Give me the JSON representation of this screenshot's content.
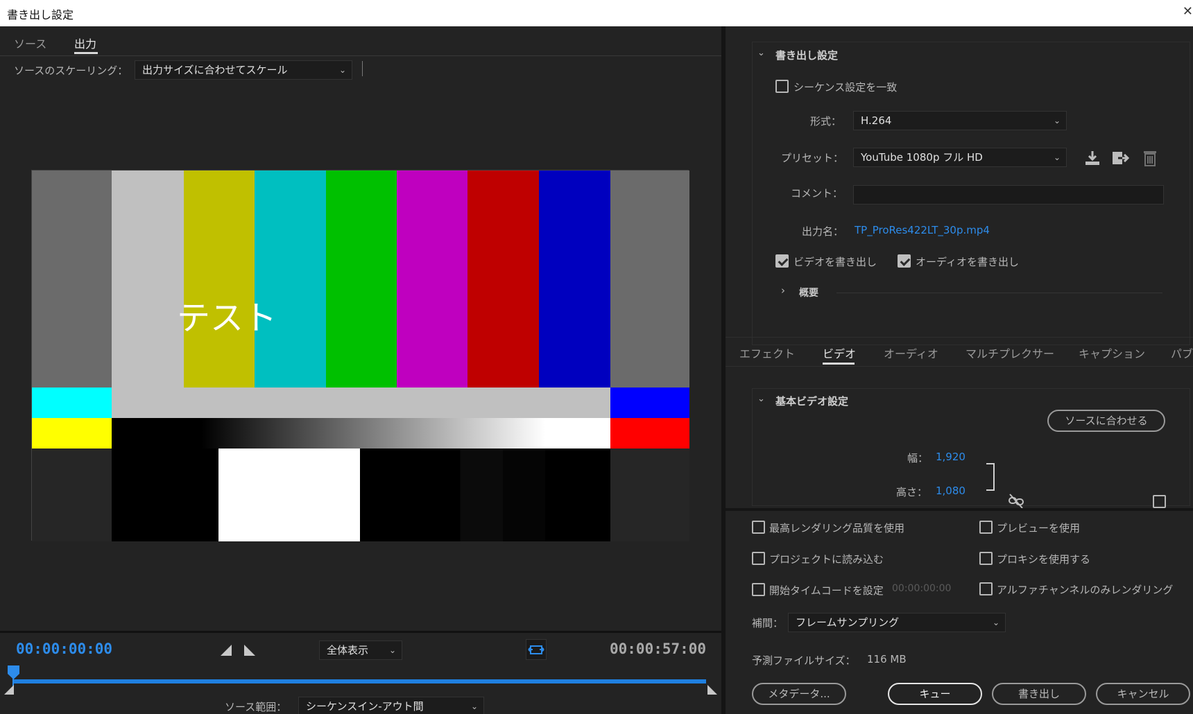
{
  "window": {
    "title": "書き出し設定",
    "close_glyph": "✕"
  },
  "left": {
    "tabs": [
      {
        "label": "ソース"
      },
      {
        "label": "出力"
      }
    ],
    "active_tab": "出力",
    "scaling": {
      "label": "ソースのスケーリング：",
      "value": "出力サイズに合わせてスケール"
    },
    "preview_overlay_text": "テスト",
    "timeline": {
      "current_time": "00:00:00:00",
      "end_time": "00:00:57:00",
      "zoom": "全体表示",
      "source_range_label": "ソース範囲：",
      "source_range_value": "シーケンスイン-アウト間"
    }
  },
  "export_settings": {
    "header": "書き出し設定",
    "match_sequence": {
      "label": "シーケンス設定を一致",
      "checked": false
    },
    "format": {
      "label": "形式：",
      "value": "H.264"
    },
    "preset": {
      "label": "プリセット：",
      "value": "YouTube  1080p フル HD"
    },
    "comment": {
      "label": "コメント：",
      "value": ""
    },
    "output_name": {
      "label": "出力名：",
      "value": "TP_ProRes422LT_30p.mp4"
    },
    "export_video": {
      "label": "ビデオを書き出し",
      "checked": true
    },
    "export_audio": {
      "label": "オーディオを書き出し",
      "checked": true
    },
    "summary": "概要"
  },
  "settings_tabs": [
    {
      "label": "エフェクト"
    },
    {
      "label": "ビデオ"
    },
    {
      "label": "オーディオ"
    },
    {
      "label": "マルチプレクサー"
    },
    {
      "label": "キャプション"
    },
    {
      "label": "パブ"
    }
  ],
  "active_settings_tab": "ビデオ",
  "basic_video": {
    "header": "基本ビデオ設定",
    "match_source": "ソースに合わせる",
    "width_label": "幅：",
    "width": "1,920",
    "height_label": "高さ：",
    "height": "1,080"
  },
  "options": {
    "max_render_quality": {
      "label": "最高レンダリング品質を使用",
      "checked": false
    },
    "use_previews": {
      "label": "プレビューを使用",
      "checked": false
    },
    "import_into_project": {
      "label": "プロジェクトに読み込む",
      "checked": false
    },
    "use_proxies": {
      "label": "プロキシを使用する",
      "checked": false
    },
    "start_timecode": {
      "label": "開始タイムコードを設定",
      "value": "00:00:00:00",
      "checked": false
    },
    "alpha_only": {
      "label": "アルファチャンネルのみレンダリング",
      "checked": false
    },
    "interpolation": {
      "label": "補間：",
      "value": "フレームサンプリング"
    },
    "estimated_size": {
      "label": "予測ファイルサイズ：",
      "value": "116 MB"
    }
  },
  "buttons": {
    "metadata": "メタデータ...",
    "queue": "キュー",
    "export": "書き出し",
    "cancel": "キャンセル"
  },
  "colors": {
    "accent_blue": "#2d8ceb",
    "panel_bg": "#232323",
    "bars_top": [
      "#6b6b6b",
      "#c0c0c0",
      "#c0c000",
      "#00bfc0",
      "#00c000",
      "#bf00bf",
      "#bf0000",
      "#0000bf",
      "#6b6b6b"
    ]
  }
}
